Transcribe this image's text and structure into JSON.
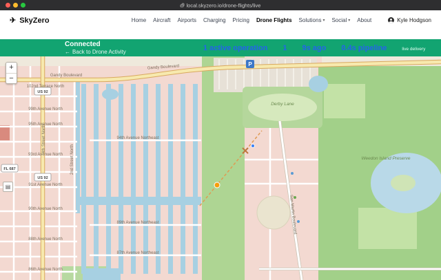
{
  "browser": {
    "url": "local.skyzero.io/drone-flights/live"
  },
  "header": {
    "brand": "SkyZero",
    "plane_icon": "✈",
    "caret_icon": "▾",
    "nav": [
      {
        "label": "Home"
      },
      {
        "label": "Aircraft"
      },
      {
        "label": "Airports"
      },
      {
        "label": "Charging"
      },
      {
        "label": "Pricing"
      },
      {
        "label": "Drone Flights"
      },
      {
        "label": "Solutions"
      },
      {
        "label": "Social"
      },
      {
        "label": "About"
      }
    ],
    "user": {
      "name": "Kyle Hodgson"
    }
  },
  "status": {
    "connected": "Connected",
    "back_arrow": "←",
    "back_label": "Back to Drone Activity",
    "metrics": {
      "active": "1 active operation",
      "queue": "1",
      "last_update": "9s ago",
      "pipeline": "0.4s pipeline",
      "live": "live delivery"
    }
  },
  "map": {
    "zoom_in": "+",
    "zoom_out": "−",
    "layers_icon": "▤",
    "shields": {
      "us92": "US 92",
      "fl687": "FL 687"
    },
    "labels": {
      "gandy": "Gandy Boulevard",
      "terrace_102": "102nd Terrace North",
      "street_4th": "4th Street North",
      "street_2nd": "2nd Street North",
      "ave_99": "99th Avenue North",
      "ave_95": "95th Avenue North",
      "ave_94": "94th Avenue Northeast",
      "ave_93": "93rd Avenue North",
      "ave_91": "91st Avenue North",
      "ave_90": "90th Avenue North",
      "ave_89": "89th Avenue Northeast",
      "ave_88": "88th Avenue North",
      "ave_87": "87th Avenue Northeast",
      "ave_86": "86th Avenue North",
      "derby": "Derby Lane",
      "weedon": "Weedon Island Preserve",
      "san_martin": "San Martin Boulevard",
      "parking_glyph": "P"
    }
  },
  "colors": {
    "status_green": "#12a471",
    "metric_blue": "#2563eb",
    "water": "#a7d0e2",
    "park_green": "#a2d089",
    "residential_pink": "#f3d9d1",
    "road_yellow": "#f7e9ae",
    "flight_orange": "#f59e0b"
  }
}
